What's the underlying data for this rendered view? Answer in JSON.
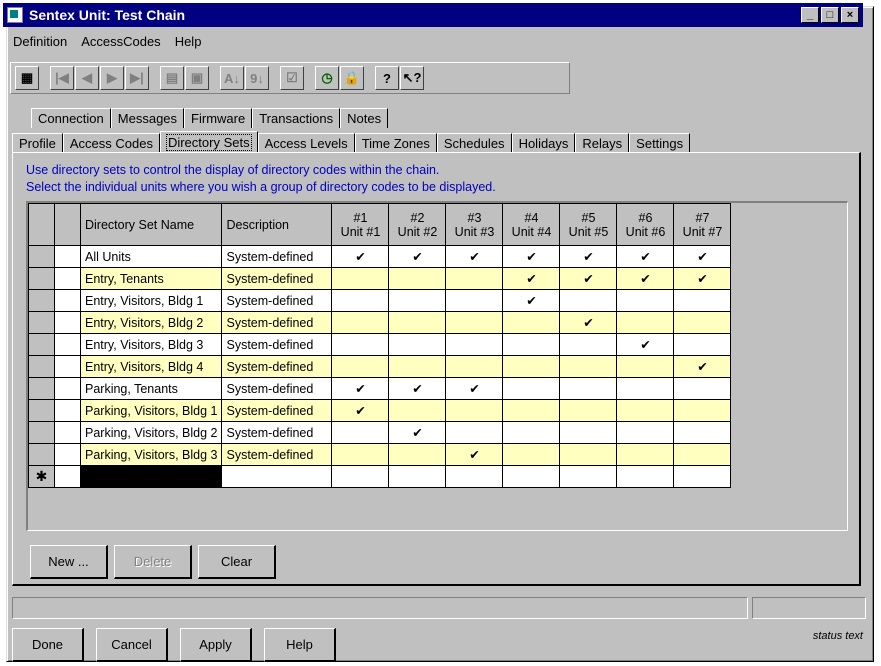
{
  "window": {
    "title": "Sentex Unit: Test Chain"
  },
  "title_buttons": [
    "_",
    "□",
    "×"
  ],
  "menu": [
    "Definition",
    "AccessCodes",
    "Help"
  ],
  "toolbar": [
    {
      "icon": "unit-icon",
      "glyph": "▦"
    },
    {
      "icon": "first-icon",
      "glyph": "|◀"
    },
    {
      "icon": "prev-icon",
      "glyph": "◀"
    },
    {
      "icon": "next-icon",
      "glyph": "▶"
    },
    {
      "icon": "last-icon",
      "glyph": "▶|"
    },
    {
      "icon": "copy-icon",
      "glyph": "▤"
    },
    {
      "icon": "view-icon",
      "glyph": "▣"
    },
    {
      "icon": "sort-asc-icon",
      "glyph": "A↓"
    },
    {
      "icon": "sort-desc-icon",
      "glyph": "9↓"
    },
    {
      "icon": "check-icon",
      "glyph": "☑"
    },
    {
      "icon": "schedule-icon",
      "glyph": "◷"
    },
    {
      "icon": "lock-icon",
      "glyph": "🔒"
    },
    {
      "icon": "whats-this-icon",
      "glyph": "?"
    },
    {
      "icon": "help-pointer-icon",
      "glyph": "↖?"
    }
  ],
  "tabs_back": [
    "Connection",
    "Messages",
    "Firmware",
    "Transactions",
    "Notes"
  ],
  "tabs_front": [
    "Profile",
    "Access Codes",
    "Directory Sets",
    "Access Levels",
    "Time Zones",
    "Schedules",
    "Holidays",
    "Relays",
    "Settings"
  ],
  "active_tab": "Directory Sets",
  "hint": {
    "line1": "Use directory sets to control the display of directory codes within the chain.",
    "line2": "Select the individual units where you wish a group of directory codes to be displayed."
  },
  "grid": {
    "col_name": "Directory Set Name",
    "col_desc": "Description",
    "units": [
      {
        "num": "#1",
        "name": "Unit #1"
      },
      {
        "num": "#2",
        "name": "Unit #2"
      },
      {
        "num": "#3",
        "name": "Unit #3"
      },
      {
        "num": "#4",
        "name": "Unit #4"
      },
      {
        "num": "#5",
        "name": "Unit #5"
      },
      {
        "num": "#6",
        "name": "Unit #6"
      },
      {
        "num": "#7",
        "name": "Unit #7"
      }
    ],
    "check_glyph": "✔",
    "new_row_marker": "✱",
    "rows": [
      {
        "name": "All Units",
        "desc": "System-defined",
        "checks": [
          1,
          1,
          1,
          1,
          1,
          1,
          1
        ]
      },
      {
        "name": "Entry, Tenants",
        "desc": "System-defined",
        "checks": [
          0,
          0,
          0,
          1,
          1,
          1,
          1
        ]
      },
      {
        "name": "Entry, Visitors, Bldg 1",
        "desc": "System-defined",
        "checks": [
          0,
          0,
          0,
          1,
          0,
          0,
          0
        ]
      },
      {
        "name": "Entry, Visitors, Bldg 2",
        "desc": "System-defined",
        "checks": [
          0,
          0,
          0,
          0,
          1,
          0,
          0
        ]
      },
      {
        "name": "Entry, Visitors, Bldg 3",
        "desc": "System-defined",
        "checks": [
          0,
          0,
          0,
          0,
          0,
          1,
          0
        ]
      },
      {
        "name": "Entry, Visitors, Bldg 4",
        "desc": "System-defined",
        "checks": [
          0,
          0,
          0,
          0,
          0,
          0,
          1
        ]
      },
      {
        "name": "Parking, Tenants",
        "desc": "System-defined",
        "checks": [
          1,
          1,
          1,
          0,
          0,
          0,
          0
        ]
      },
      {
        "name": "Parking, Visitors, Bldg 1",
        "desc": "System-defined",
        "checks": [
          1,
          0,
          0,
          0,
          0,
          0,
          0
        ]
      },
      {
        "name": "Parking, Visitors, Bldg 2",
        "desc": "System-defined",
        "checks": [
          0,
          1,
          0,
          0,
          0,
          0,
          0
        ]
      },
      {
        "name": "Parking, Visitors, Bldg 3",
        "desc": "System-defined",
        "checks": [
          0,
          0,
          1,
          0,
          0,
          0,
          0
        ]
      }
    ]
  },
  "panel_buttons": {
    "new": "New ...",
    "delete": "Delete",
    "clear": "Clear"
  },
  "bottom_buttons": {
    "done": "Done",
    "cancel": "Cancel",
    "apply": "Apply",
    "help": "Help"
  },
  "status_text": "status text",
  "colors": {
    "title_bg": "#000080",
    "row_highlight": "#ffffc0",
    "hint_text": "#0000c0"
  }
}
